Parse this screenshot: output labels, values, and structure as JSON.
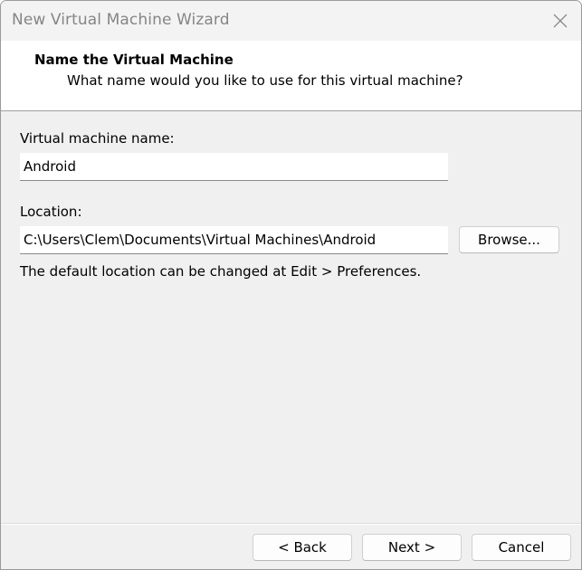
{
  "window": {
    "title": "New Virtual Machine Wizard"
  },
  "header": {
    "title": "Name the Virtual Machine",
    "subtitle": "What name would you like to use for this virtual machine?"
  },
  "form": {
    "vm_name_label": "Virtual machine name:",
    "vm_name_value": "Android",
    "location_label": "Location:",
    "location_value": "C:\\Users\\Clem\\Documents\\Virtual Machines\\Android",
    "browse_label": "Browse...",
    "hint": "The default location can be changed at Edit > Preferences."
  },
  "footer": {
    "back_label": "< Back",
    "next_label": "Next >",
    "cancel_label": "Cancel"
  },
  "icons": {
    "close": "close-icon"
  }
}
